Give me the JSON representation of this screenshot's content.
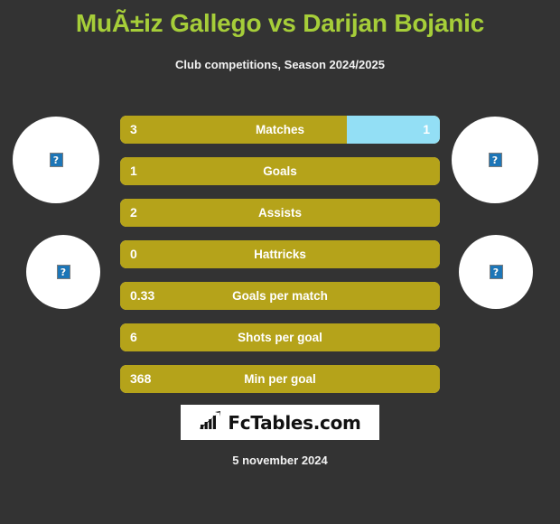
{
  "header": {
    "title": "MuÃ±iz Gallego vs Darijan Bojanic",
    "subtitle": "Club competitions, Season 2024/2025"
  },
  "colors": {
    "background": "#333333",
    "title": "#a6ce39",
    "bar_home": "#b5a31a",
    "bar_away": "#93dff5",
    "text": "#ffffff",
    "logo_background": "#ffffff"
  },
  "avatars": [
    {
      "name": "home-player-photo",
      "placeholder": "?"
    },
    {
      "name": "away-player-photo",
      "placeholder": "?"
    },
    {
      "name": "home-team-logo",
      "placeholder": "?"
    },
    {
      "name": "away-team-logo",
      "placeholder": "?"
    }
  ],
  "chart_data": {
    "type": "bar",
    "title": "MuÃ±iz Gallego vs Darijan Bojanic",
    "subtitle": "Club competitions, Season 2024/2025",
    "xlabel": "",
    "ylabel": "",
    "grid": false,
    "legend": "none",
    "categories": [
      "Matches",
      "Goals",
      "Assists",
      "Hattricks",
      "Goals per match",
      "Shots per goal",
      "Min per goal"
    ],
    "series": [
      {
        "name": "MuÃ±iz Gallego",
        "color": "#b5a31a",
        "values": [
          "3",
          "1",
          "2",
          "0",
          "0.33",
          "6",
          "368"
        ]
      },
      {
        "name": "Darijan Bojanic",
        "color": "#93dff5",
        "values": [
          "1",
          "",
          "",
          "",
          "",
          "",
          ""
        ]
      }
    ],
    "rows": [
      {
        "label": "Matches",
        "home": "3",
        "away": "1",
        "home_pct": 71,
        "away_pct": 29,
        "split": true
      },
      {
        "label": "Goals",
        "home": "1",
        "away": "",
        "home_pct": 100,
        "away_pct": 0,
        "split": false
      },
      {
        "label": "Assists",
        "home": "2",
        "away": "",
        "home_pct": 100,
        "away_pct": 0,
        "split": false
      },
      {
        "label": "Hattricks",
        "home": "0",
        "away": "",
        "home_pct": 100,
        "away_pct": 0,
        "split": false
      },
      {
        "label": "Goals per match",
        "home": "0.33",
        "away": "",
        "home_pct": 100,
        "away_pct": 0,
        "split": false
      },
      {
        "label": "Shots per goal",
        "home": "6",
        "away": "",
        "home_pct": 100,
        "away_pct": 0,
        "split": false
      },
      {
        "label": "Min per goal",
        "home": "368",
        "away": "",
        "home_pct": 100,
        "away_pct": 0,
        "split": false
      }
    ]
  },
  "logo": {
    "text": "FcTables.com",
    "icon": "bar-chart-icon"
  },
  "footer": {
    "date": "5 november 2024"
  }
}
